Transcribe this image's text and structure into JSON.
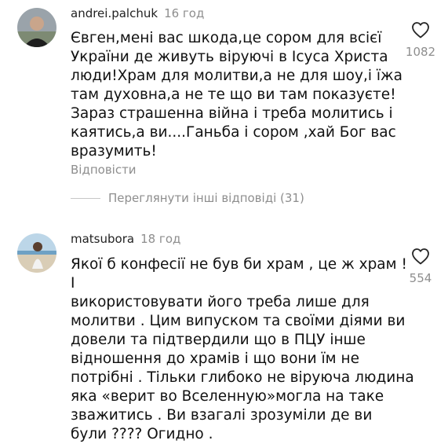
{
  "comments": [
    {
      "username": "andrei.palchuk",
      "time": "16 год",
      "text": "Євген,мені вас шкода,це сором для всієї\nУкраїни де живуть віруючі в Ісуса Христа\nлюди!Храм для молитви,а не для шоу,і їжа\nтам духовна,а не те що ви там показуєте!\nЗараз страшенна війна і треба молитись і\nкаятись,а ви....Ганьба і сором ,хай Бог вас\nвразумить!",
      "reply_label": "Відповісти",
      "likes": "1082",
      "icon": "heart-outline-icon"
    },
    {
      "username": "matsubora",
      "time": "18 год",
      "text": "Якої  б конфесії не був би храм , це ж храм ! І\nвикористовувати його треба лише для\nмолитви . Цим випуском та своїми діями ви\nдовели та підтвердили що в ПЦУ інше\nвідношення до храмів і що вони їм не\nпотрібні . Тільки глибоко  не віруюча людина\nяка «верит во Вселенную»могла на таке\nзважитись . Ви взагалі зрозуміли де ви\nбули ???? Огидно .",
      "likes": "554",
      "icon": "heart-outline-icon"
    }
  ],
  "view_replies": "Переглянути інші відповіді (31)",
  "colors": {
    "text": "#111111",
    "muted": "#8e8e8e",
    "divider": "#c7c7c7"
  }
}
